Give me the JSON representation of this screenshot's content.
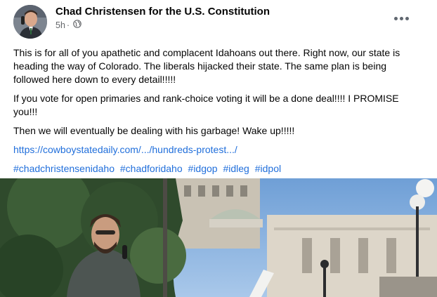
{
  "post": {
    "author": "Chad Christensen for the U.S. Constitution",
    "time": "5h",
    "separator": "·",
    "audience_icon": "globe-icon",
    "more_icon": "more-options-icon",
    "paragraphs": [
      "This is for all of you apathetic and complacent Idahoans out there. Right now, our state is heading the way of Colorado. The liberals hijacked their state. The same plan is being followed here down to every detail!!!!!",
      "If you vote for open primaries and rank-choice voting it will be a done deal!!!! I PROMISE you!!!",
      "Then we will eventually be dealing with his garbage! Wake up!!!!!"
    ],
    "link": "https://cowboystatedaily.com/.../hundreds-protest.../",
    "hashtags": [
      "#chadchristensenidaho",
      "#chadforidaho",
      "#idgop",
      "#idleg",
      "#idpol"
    ],
    "colors": {
      "link": "#216fdb",
      "meta": "#65676b",
      "text": "#050505"
    }
  }
}
